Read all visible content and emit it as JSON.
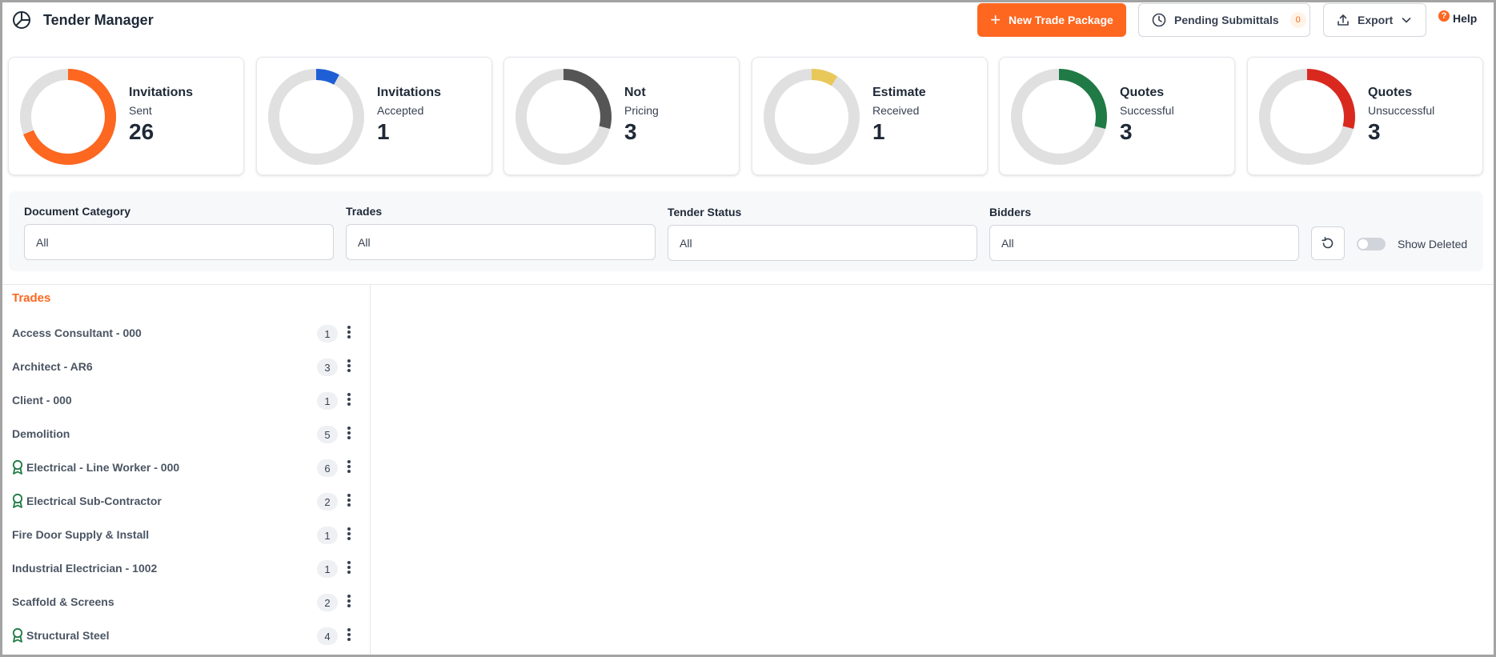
{
  "app": {
    "title": "Tender Manager",
    "icon": "pie-chart-icon"
  },
  "toolbar": {
    "new_trade_package": "New Trade Package",
    "pending_submittals": "Pending Submittals",
    "pending_count": "0",
    "export": "Export",
    "help": "Help"
  },
  "colors": {
    "accent": "#fd6720",
    "track": "#e0e0e0",
    "accepted": "#1f5fd6",
    "not_pricing": "#555555",
    "estimate": "#e8c859",
    "successful": "#1f7a45",
    "unsuccessful": "#d9291f"
  },
  "stats": [
    {
      "line1": "Invitations",
      "line2": "Sent",
      "value": "26",
      "fraction": 0.69,
      "color": "#fd6720"
    },
    {
      "line1": "Invitations",
      "line2": "Accepted",
      "value": "1",
      "fraction": 0.08,
      "color": "#1f5fd6"
    },
    {
      "line1": "Not",
      "line2": "Pricing",
      "value": "3",
      "fraction": 0.29,
      "color": "#555555"
    },
    {
      "line1": "Estimate",
      "line2": "Received",
      "value": "1",
      "fraction": 0.09,
      "color": "#e8c859"
    },
    {
      "line1": "Quotes",
      "line2": "Successful",
      "value": "3",
      "fraction": 0.29,
      "color": "#1f7a45"
    },
    {
      "line1": "Quotes",
      "line2": "Unsuccessful",
      "value": "3",
      "fraction": 0.29,
      "color": "#d9291f"
    }
  ],
  "filters": {
    "document_category": {
      "label": "Document Category",
      "value": "All"
    },
    "trades": {
      "label": "Trades",
      "value": "All"
    },
    "tender_status": {
      "label": "Tender Status",
      "value": "All"
    },
    "bidders": {
      "label": "Bidders",
      "value": "All"
    },
    "show_deleted": "Show Deleted",
    "show_deleted_on": false
  },
  "trades": {
    "title": "Trades",
    "items": [
      {
        "name": "Access Consultant - 000",
        "count": "1",
        "awarded": false
      },
      {
        "name": "Architect - AR6",
        "count": "3",
        "awarded": false
      },
      {
        "name": "Client - 000",
        "count": "1",
        "awarded": false
      },
      {
        "name": "Demolition",
        "count": "5",
        "awarded": false
      },
      {
        "name": "Electrical - Line Worker - 000",
        "count": "6",
        "awarded": true
      },
      {
        "name": "Electrical Sub-Contractor",
        "count": "2",
        "awarded": true
      },
      {
        "name": "Fire Door Supply & Install",
        "count": "1",
        "awarded": false
      },
      {
        "name": "Industrial Electrician - 1002",
        "count": "1",
        "awarded": false
      },
      {
        "name": "Scaffold & Screens",
        "count": "2",
        "awarded": false
      },
      {
        "name": "Structural Steel",
        "count": "4",
        "awarded": true
      }
    ]
  }
}
